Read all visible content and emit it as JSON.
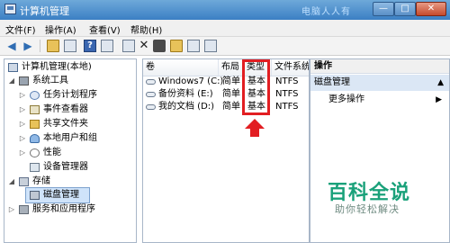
{
  "window": {
    "title": "计算机管理",
    "watermark": "电脑人人有",
    "controls": {
      "minimize": "—",
      "maximize": "□",
      "close": "✕"
    }
  },
  "menu": {
    "file": "文件(F)",
    "action": "操作(A)",
    "view": "查看(V)",
    "help": "帮助(H)"
  },
  "toolbar": {
    "back_icon": "arrow-left-icon",
    "forward_icon": "arrow-right-icon",
    "back_glyph": "◀",
    "forward_glyph": "▶",
    "help_glyph": "?",
    "delete_glyph": "✕"
  },
  "tree": {
    "root": "计算机管理(本地)",
    "system_tools": "系统工具",
    "task_scheduler": "任务计划程序",
    "event_viewer": "事件查看器",
    "shared_folders": "共享文件夹",
    "local_users": "本地用户和组",
    "performance": "性能",
    "device_manager": "设备管理器",
    "storage": "存储",
    "disk_management": "磁盘管理",
    "services": "服务和应用程序",
    "expanded_glyph": "◢",
    "collapsed_glyph": "▷"
  },
  "table": {
    "headers": {
      "volume": "卷",
      "layout": "布局",
      "type": "类型",
      "filesystem": "文件系统"
    },
    "rows": [
      {
        "volume": "Windows7 (C:)",
        "layout": "简单",
        "type": "基本",
        "fs": "NTFS"
      },
      {
        "volume": "备份资料 (E:)",
        "layout": "简单",
        "type": "基本",
        "fs": "NTFS"
      },
      {
        "volume": "我的文档 (D:)",
        "layout": "简单",
        "type": "基本",
        "fs": "NTFS"
      }
    ]
  },
  "actions": {
    "header": "操作",
    "section": "磁盘管理",
    "more": "更多操作",
    "section_arrow": "▲",
    "more_arrow": "▶"
  },
  "branding": {
    "main": "百科全说",
    "sub": "助你轻松解决"
  },
  "colors": {
    "highlight": "#e21e22",
    "brand_green": "#1aa17a",
    "titlebar": "#3b7fc4"
  }
}
